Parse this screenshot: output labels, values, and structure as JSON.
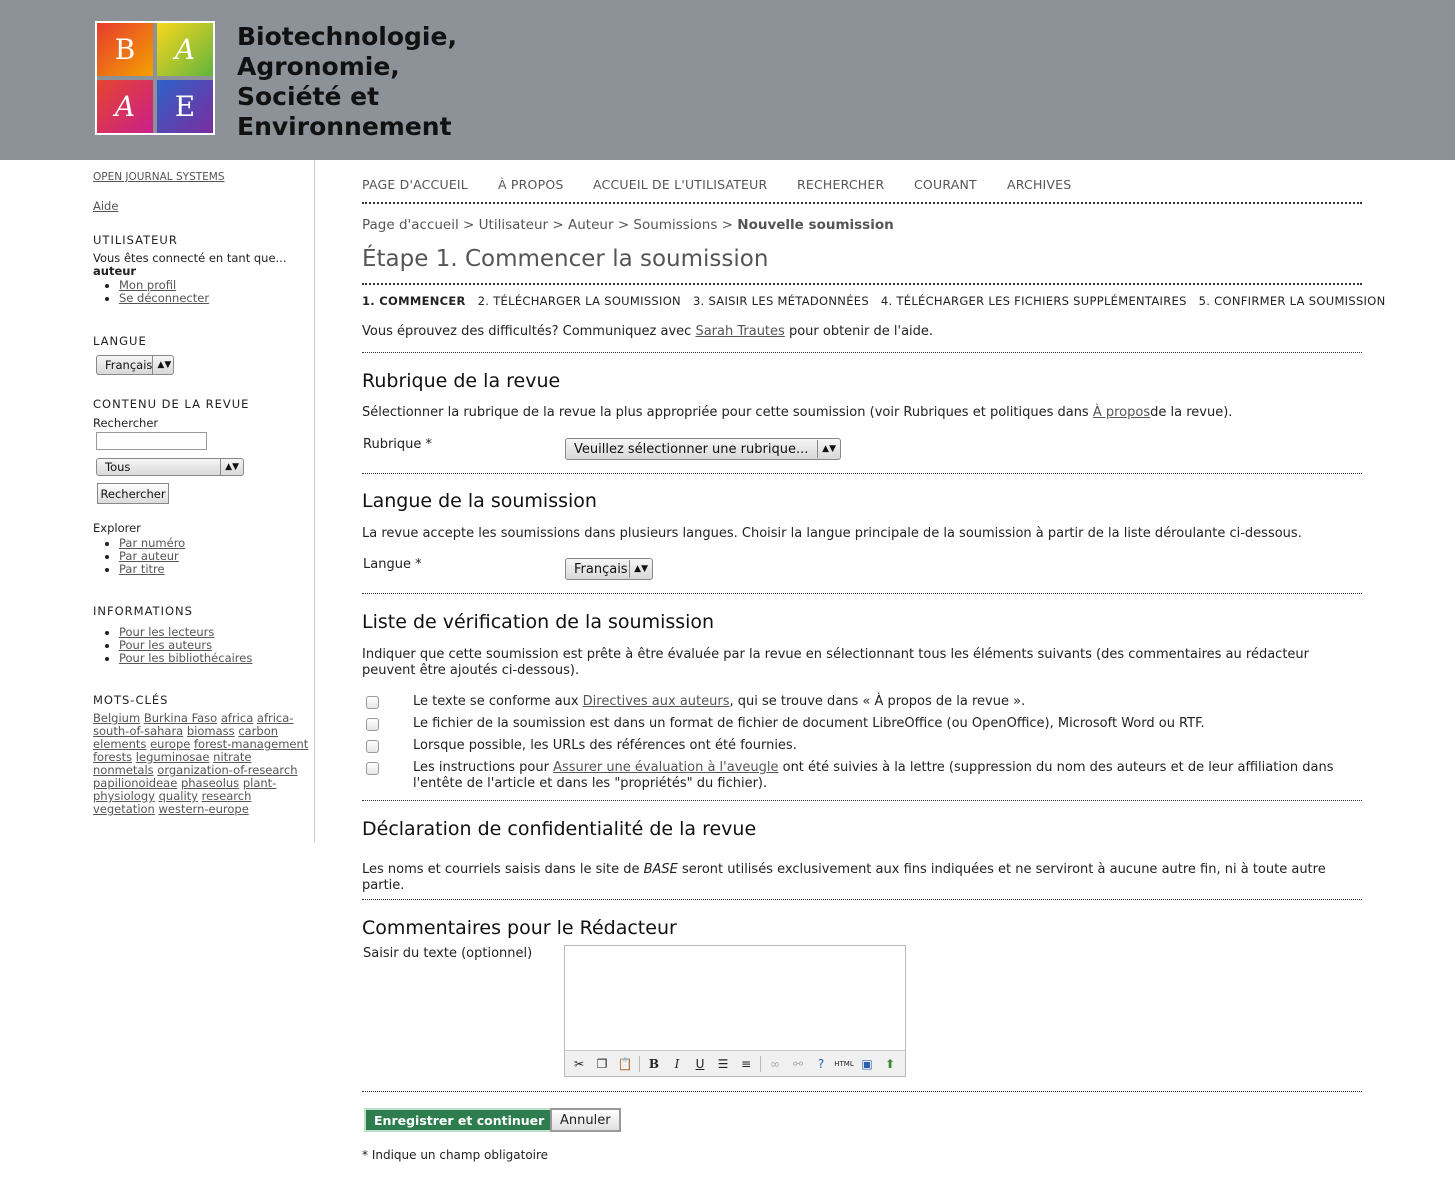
{
  "header": {
    "logo_letters": [
      "B",
      "A",
      "A",
      "E"
    ],
    "title_lines": [
      "Biotechnologie,",
      "Agronomie,",
      "Société et",
      "Environnement"
    ]
  },
  "sidebar": {
    "ojs_link": "OPEN JOURNAL SYSTEMS",
    "help_link": "Aide",
    "user_block": {
      "title": "UTILISATEUR",
      "logged_in_as": "Vous êtes connecté en tant que...",
      "username": "auteur",
      "links": [
        "Mon profil",
        "Se déconnecter"
      ]
    },
    "language_block": {
      "title": "LANGUE",
      "selected": "Français"
    },
    "content_block": {
      "title": "CONTENU DE LA REVUE",
      "search_label": "Rechercher",
      "search_value": "",
      "scope_selected": "Tous",
      "search_button": "Rechercher",
      "browse_label": "Explorer",
      "browse_links": [
        "Par numéro",
        "Par auteur",
        "Par titre"
      ]
    },
    "info_block": {
      "title": "INFORMATIONS",
      "links": [
        "Pour les lecteurs",
        "Pour les auteurs",
        "Pour les bibliothécaires"
      ]
    },
    "keywords_block": {
      "title": "MOTS-CLÉS",
      "keywords": [
        "Belgium",
        "Burkina Faso",
        "africa",
        "africa-south-of-sahara",
        "biomass",
        "carbon",
        "elements",
        "europe",
        "forest-management",
        "forests",
        "leguminosae",
        "nitrate",
        "nonmetals",
        "organization-of-research",
        "papilionoideae",
        "phaseolus",
        "plant-physiology",
        "quality",
        "research",
        "vegetation",
        "western-europe"
      ]
    }
  },
  "nav": {
    "items": [
      "PAGE D'ACCUEIL",
      "À PROPOS",
      "ACCUEIL DE L'UTILISATEUR",
      "RECHERCHER",
      "COURANT",
      "ARCHIVES"
    ]
  },
  "breadcrumb": {
    "items": [
      "Page d'accueil",
      "Utilisateur",
      "Auteur",
      "Soumissions"
    ],
    "current": "Nouvelle soumission",
    "separator": ">"
  },
  "page_title": "Étape 1. Commencer la soumission",
  "steps": [
    "1. COMMENCER",
    "2. TÉLÉCHARGER LA SOUMISSION",
    "3. SAISIR LES MÉTADONNÉES",
    "4. TÉLÉCHARGER LES FICHIERS SUPPLÉMENTAIRES",
    "5. CONFIRMER LA SOUMISSION"
  ],
  "help": {
    "before": "Vous éprouvez des difficultés? Communiquez avec ",
    "contact": "Sarah Trautes",
    "after": " pour obtenir de l'aide."
  },
  "section_rubric": {
    "title": "Rubrique de la revue",
    "description_before": "Sélectionner la rubrique de la revue la plus appropriée pour cette soumission (voir Rubriques et politiques dans ",
    "description_link": "À propos",
    "description_after": "de la revue).",
    "field_label": "Rubrique *",
    "select_value": "Veuillez sélectionner une rubrique..."
  },
  "section_language": {
    "title": "Langue de la soumission",
    "description": "La revue accepte les soumissions dans plusieurs langues. Choisir la langue principale de la soumission à partir de la liste déroulante ci-dessous.",
    "field_label": "Langue *",
    "select_value": "Français"
  },
  "section_checklist": {
    "title": "Liste de vérification de la soumission",
    "description": "Indiquer que cette soumission est prête à être évaluée par la revue en sélectionnant tous les éléments suivants (des commentaires au rédacteur peuvent être ajoutés ci-dessous).",
    "items": [
      {
        "before": "Le texte se conforme aux ",
        "link": "Directives aux auteurs",
        "after": ", qui se trouve dans « À propos de la revue ».",
        "checked": false
      },
      {
        "before": "Le fichier de la soumission est dans un format de fichier de document LibreOffice (ou OpenOffice), Microsoft Word ou RTF.",
        "link": "",
        "after": "",
        "checked": false
      },
      {
        "before": "Lorsque possible, les URLs des références ont été fournies.",
        "link": "",
        "after": "",
        "checked": false
      },
      {
        "before": "Les instructions pour ",
        "link": "Assurer une évaluation à l'aveugle",
        "after": " ont été suivies à la lettre (suppression du nom des auteurs et de leur affiliation dans l'entête de l'article et dans les \"propriétés\" du fichier).",
        "checked": false
      }
    ]
  },
  "section_privacy": {
    "title": "Déclaration de confidentialité de la revue",
    "text_before": "Les noms et courriels saisis dans le site de ",
    "text_em": "BASE",
    "text_after": " seront utilisés exclusivement aux fins indiquées et ne serviront à aucune autre fin, ni à toute autre partie."
  },
  "section_comments": {
    "title": "Commentaires pour le Rédacteur",
    "field_label": "Saisir du texte (optionnel)",
    "value": "",
    "toolbar_icons": [
      "cut-icon",
      "copy-icon",
      "paste-icon",
      "bold-icon",
      "italic-icon",
      "underline-icon",
      "bullet-list-icon",
      "numbered-list-icon",
      "link-icon",
      "unlink-icon",
      "help-icon",
      "html-icon",
      "fullscreen-icon",
      "upload-image-icon"
    ]
  },
  "buttons": {
    "save": "Enregistrer et continuer",
    "cancel": "Annuler"
  },
  "required_note": "* Indique un champ obligatoire",
  "colors": {
    "header_bg": "#8d9298",
    "save_button_bg": "#2e7d4f",
    "link": "#555555"
  }
}
